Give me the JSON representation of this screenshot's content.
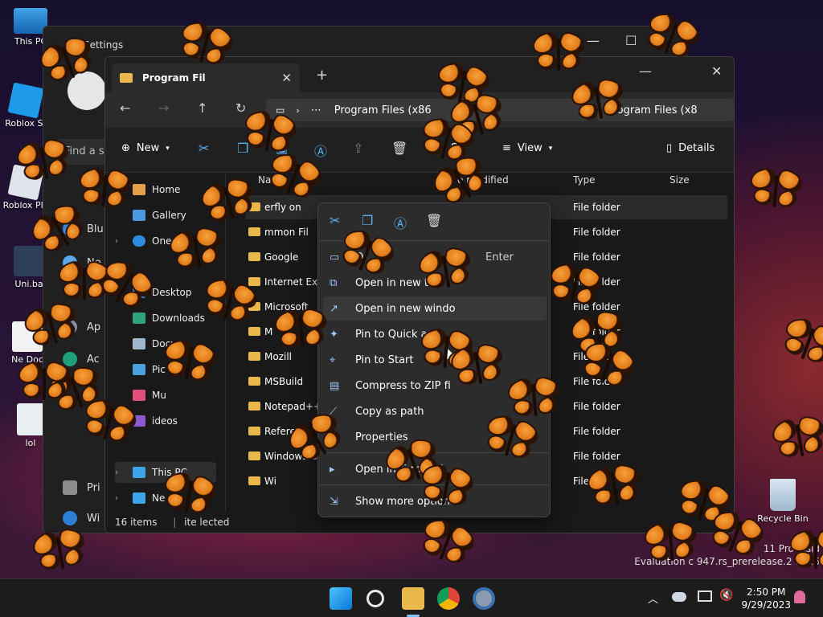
{
  "desktop": {
    "icons": [
      {
        "label": "This PC"
      },
      {
        "label": "Roblox St"
      },
      {
        "label": "Roblox Pla"
      },
      {
        "label": "Uni.ba"
      },
      {
        "label": "Ne Doc"
      },
      {
        "label": "lol"
      },
      {
        "label": "Recycle Bin"
      }
    ],
    "watermark": {
      "line1": "11 Pro Insid",
      "line2": "Evaluation c",
      "line3": "947.rs_prerelease.2",
      "line4": "1416"
    }
  },
  "settings": {
    "title": "Settings",
    "search_placeholder": "Find a s",
    "side_items": [
      "Blu",
      "Ne",
      "Ap",
      "Ac",
      "Pri",
      "Wi"
    ]
  },
  "explorer": {
    "tab_title": "Program Fil",
    "address": "Program Files (x86",
    "search": "Program Files (x8",
    "toolbar": {
      "new": "New",
      "sort": "So",
      "view": "View",
      "details": "Details"
    },
    "nav": [
      {
        "label": "Home"
      },
      {
        "label": "Gallery"
      },
      {
        "label": "One"
      },
      {
        "label": "Desktop"
      },
      {
        "label": "Downloads"
      },
      {
        "label": "Docum"
      },
      {
        "label": "Pic"
      },
      {
        "label": "Mu"
      },
      {
        "label": "ideos"
      },
      {
        "label": "This PC"
      },
      {
        "label": "Ne"
      }
    ],
    "columns": {
      "name": "Nam",
      "date": "e modified",
      "type": "Type",
      "size": "Size"
    },
    "rows": [
      {
        "name": "erfly on",
        "type": "File folder"
      },
      {
        "name": "mmon Fil",
        "type": "File folder"
      },
      {
        "name": "Google",
        "type": "File folder"
      },
      {
        "name": "Internet Expl",
        "type": "File folder"
      },
      {
        "name": "Microsoft",
        "type": "File folder"
      },
      {
        "name": "M",
        "type": "File folder"
      },
      {
        "name": "Mozill",
        "type": "File folder"
      },
      {
        "name": "MSBuild",
        "type": "File folder"
      },
      {
        "name": "Notepad++",
        "type": "File folder"
      },
      {
        "name": "Referenc",
        "type": "File folder"
      },
      {
        "name": "Windows D",
        "type": "File folder"
      },
      {
        "name": "Wi",
        "type": "File fo"
      }
    ],
    "status": {
      "items": "16 items",
      "selected": "ite    lected"
    }
  },
  "context_menu": {
    "items": [
      {
        "label": "O",
        "shortcut": "Enter"
      },
      {
        "label": "Open in new tab"
      },
      {
        "label": "Open in new windo"
      },
      {
        "label": "Pin to Quick acc"
      },
      {
        "label": "Pin to Start"
      },
      {
        "label": "Compress to ZIP fi"
      },
      {
        "label": "Copy as path"
      },
      {
        "label": "Properties"
      },
      {
        "label": "Open in Terminal"
      },
      {
        "label": "Show more options"
      }
    ]
  },
  "taskbar": {
    "time": "2:50 PM",
    "date": "9/29/2023"
  },
  "colors": {
    "accent": "#5fb3f5",
    "folder": "#e8b84a",
    "butterfly": "#e8801c"
  }
}
